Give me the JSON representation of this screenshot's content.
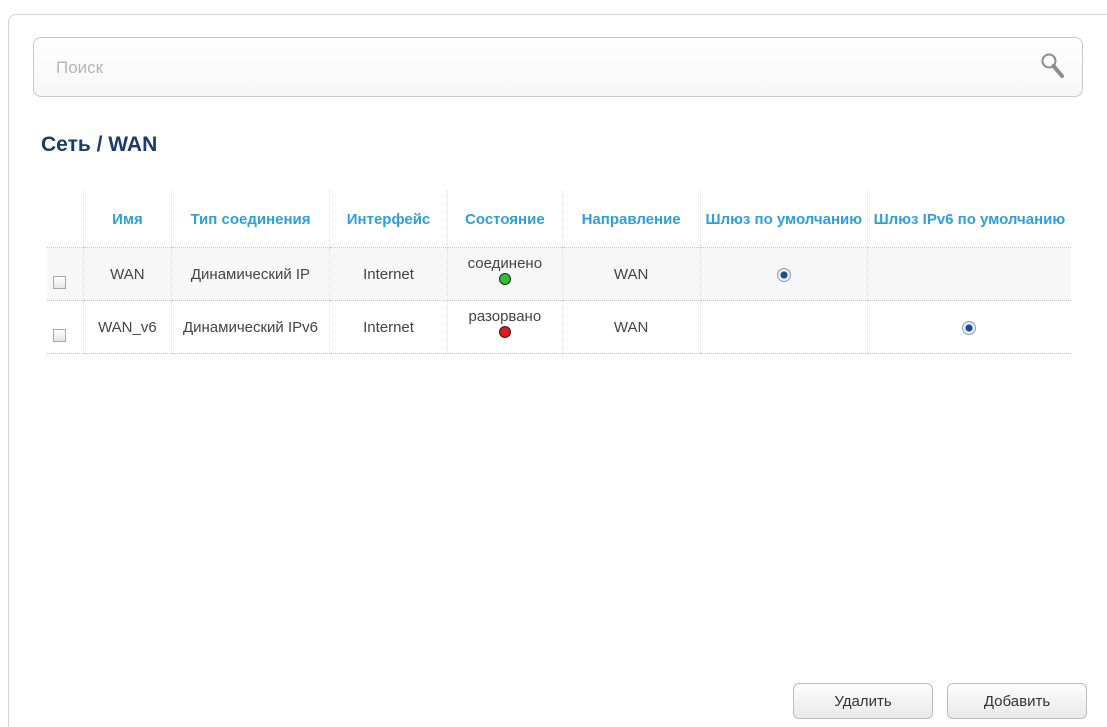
{
  "search": {
    "placeholder": "Поиск",
    "icon": "search-icon"
  },
  "page": {
    "title": "Сеть /  WAN"
  },
  "table": {
    "headers": {
      "name": "Имя",
      "conn_type": "Тип соединения",
      "interface": "Интерфейс",
      "state": "Состояние",
      "direction": "Направление",
      "gw": "Шлюз по умолчанию",
      "gw6": "Шлюз IPv6 по умолчанию"
    },
    "rows": [
      {
        "name": "WAN",
        "conn_type": "Динамический IP",
        "interface": "Internet",
        "state": "соединено",
        "state_color": "#2fbf2f",
        "direction": "WAN",
        "gw_default": true,
        "gw6_default": false
      },
      {
        "name": "WAN_v6",
        "conn_type": "Динамический IPv6",
        "interface": "Internet",
        "state": "разорвано",
        "state_color": "#e01a1a",
        "direction": "WAN",
        "gw_default": false,
        "gw6_default": true
      }
    ]
  },
  "buttons": {
    "delete": "Удалить",
    "add": "Добавить"
  },
  "colors": {
    "title": "#1b3b6b",
    "header": "#2e9fd8"
  }
}
